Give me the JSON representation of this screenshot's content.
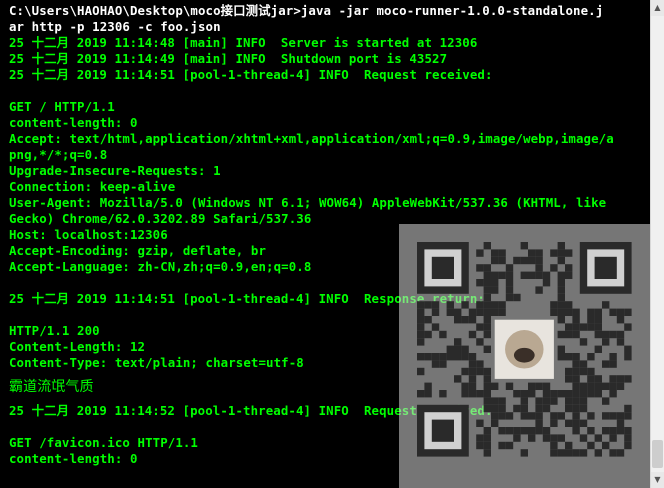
{
  "terminal": {
    "lines": [
      {
        "text": "C:\\Users\\HAOHAO\\Desktop\\moco接口测试jar>java -jar moco-runner-1.0.0-standalone.j",
        "kind": "cmd"
      },
      {
        "text": "ar http -p 12306 -c foo.json",
        "kind": "cmd"
      },
      {
        "text": "25 十二月 2019 11:14:48 [main] INFO  Server is started at 12306",
        "kind": "log"
      },
      {
        "text": "25 十二月 2019 11:14:49 [main] INFO  Shutdown port is 43527",
        "kind": "log"
      },
      {
        "text": "25 十二月 2019 11:14:51 [pool-1-thread-4] INFO  Request received:",
        "kind": "log"
      },
      {
        "text": "",
        "kind": "blank"
      },
      {
        "text": "GET / HTTP/1.1",
        "kind": "log"
      },
      {
        "text": "content-length: 0",
        "kind": "log"
      },
      {
        "text": "Accept: text/html,application/xhtml+xml,application/xml;q=0.9,image/webp,image/a",
        "kind": "log"
      },
      {
        "text": "png,*/*;q=0.8",
        "kind": "log"
      },
      {
        "text": "Upgrade-Insecure-Requests: 1",
        "kind": "log"
      },
      {
        "text": "Connection: keep-alive",
        "kind": "log"
      },
      {
        "text": "User-Agent: Mozilla/5.0 (Windows NT 6.1; WOW64) AppleWebKit/537.36 (KHTML, like",
        "kind": "log"
      },
      {
        "text": "Gecko) Chrome/62.0.3202.89 Safari/537.36",
        "kind": "log"
      },
      {
        "text": "Host: localhost:12306",
        "kind": "log"
      },
      {
        "text": "Accept-Encoding: gzip, deflate, br",
        "kind": "log"
      },
      {
        "text": "Accept-Language: zh-CN,zh;q=0.9,en;q=0.8",
        "kind": "log"
      },
      {
        "text": "",
        "kind": "blank"
      },
      {
        "text": "25 十二月 2019 11:14:51 [pool-1-thread-4] INFO  Response return:",
        "kind": "log"
      },
      {
        "text": "",
        "kind": "blank"
      },
      {
        "text": "HTTP/1.1 200",
        "kind": "log"
      },
      {
        "text": "Content-Length: 12",
        "kind": "log"
      },
      {
        "text": "Content-Type: text/plain; charset=utf-8",
        "kind": "log"
      },
      {
        "text": "霸道流氓气质",
        "kind": "chinese"
      },
      {
        "text": "25 十二月 2019 11:14:52 [pool-1-thread-4] INFO  Request received:",
        "kind": "log"
      },
      {
        "text": "",
        "kind": "blank"
      },
      {
        "text": "GET /favicon.ico HTTP/1.1",
        "kind": "log"
      },
      {
        "text": "content-length: 0",
        "kind": "log"
      }
    ]
  },
  "colors": {
    "background": "#000000",
    "text": "#00ff00",
    "command": "#ffffff"
  },
  "overlay": {
    "icon": "qr-code-icon"
  },
  "scrollbar": {
    "up_arrow": "▲",
    "down_arrow": "▼"
  }
}
